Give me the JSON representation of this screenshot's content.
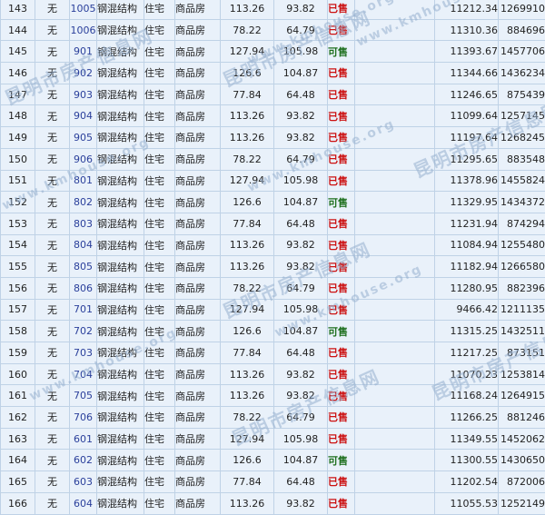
{
  "watermark": {
    "cn": "昆明市房产信息网",
    "en": "www.kmhouse.org"
  },
  "colors": {
    "sold": "#cc1111",
    "available": "#1d6f1d",
    "room": "#2a3f9b"
  },
  "rows": [
    {
      "idx": "143",
      "none": "无",
      "room": "1005",
      "struct": "钢混结构",
      "use": "住宅",
      "kind": "商品房",
      "area1": "113.26",
      "area2": "93.82",
      "status": "已售",
      "price": "11212.34",
      "total": "1269910"
    },
    {
      "idx": "144",
      "none": "无",
      "room": "1006",
      "struct": "钢混结构",
      "use": "住宅",
      "kind": "商品房",
      "area1": "78.22",
      "area2": "64.79",
      "status": "已售",
      "price": "11310.36",
      "total": "884696"
    },
    {
      "idx": "145",
      "none": "无",
      "room": "901",
      "struct": "钢混结构",
      "use": "住宅",
      "kind": "商品房",
      "area1": "127.94",
      "area2": "105.98",
      "status": "可售",
      "price": "11393.67",
      "total": "1457706"
    },
    {
      "idx": "146",
      "none": "无",
      "room": "902",
      "struct": "钢混结构",
      "use": "住宅",
      "kind": "商品房",
      "area1": "126.6",
      "area2": "104.87",
      "status": "已售",
      "price": "11344.66",
      "total": "1436234"
    },
    {
      "idx": "147",
      "none": "无",
      "room": "903",
      "struct": "钢混结构",
      "use": "住宅",
      "kind": "商品房",
      "area1": "77.84",
      "area2": "64.48",
      "status": "已售",
      "price": "11246.65",
      "total": "875439"
    },
    {
      "idx": "148",
      "none": "无",
      "room": "904",
      "struct": "钢混结构",
      "use": "住宅",
      "kind": "商品房",
      "area1": "113.26",
      "area2": "93.82",
      "status": "已售",
      "price": "11099.64",
      "total": "1257145"
    },
    {
      "idx": "149",
      "none": "无",
      "room": "905",
      "struct": "钢混结构",
      "use": "住宅",
      "kind": "商品房",
      "area1": "113.26",
      "area2": "93.82",
      "status": "已售",
      "price": "11197.64",
      "total": "1268245"
    },
    {
      "idx": "150",
      "none": "无",
      "room": "906",
      "struct": "钢混结构",
      "use": "住宅",
      "kind": "商品房",
      "area1": "78.22",
      "area2": "64.79",
      "status": "已售",
      "price": "11295.65",
      "total": "883548"
    },
    {
      "idx": "151",
      "none": "无",
      "room": "801",
      "struct": "钢混结构",
      "use": "住宅",
      "kind": "商品房",
      "area1": "127.94",
      "area2": "105.98",
      "status": "已售",
      "price": "11378.96",
      "total": "1455824"
    },
    {
      "idx": "152",
      "none": "无",
      "room": "802",
      "struct": "钢混结构",
      "use": "住宅",
      "kind": "商品房",
      "area1": "126.6",
      "area2": "104.87",
      "status": "可售",
      "price": "11329.95",
      "total": "1434372"
    },
    {
      "idx": "153",
      "none": "无",
      "room": "803",
      "struct": "钢混结构",
      "use": "住宅",
      "kind": "商品房",
      "area1": "77.84",
      "area2": "64.48",
      "status": "已售",
      "price": "11231.94",
      "total": "874294"
    },
    {
      "idx": "154",
      "none": "无",
      "room": "804",
      "struct": "钢混结构",
      "use": "住宅",
      "kind": "商品房",
      "area1": "113.26",
      "area2": "93.82",
      "status": "已售",
      "price": "11084.94",
      "total": "1255480"
    },
    {
      "idx": "155",
      "none": "无",
      "room": "805",
      "struct": "钢混结构",
      "use": "住宅",
      "kind": "商品房",
      "area1": "113.26",
      "area2": "93.82",
      "status": "已售",
      "price": "11182.94",
      "total": "1266580"
    },
    {
      "idx": "156",
      "none": "无",
      "room": "806",
      "struct": "钢混结构",
      "use": "住宅",
      "kind": "商品房",
      "area1": "78.22",
      "area2": "64.79",
      "status": "已售",
      "price": "11280.95",
      "total": "882396"
    },
    {
      "idx": "157",
      "none": "无",
      "room": "701",
      "struct": "钢混结构",
      "use": "住宅",
      "kind": "商品房",
      "area1": "127.94",
      "area2": "105.98",
      "status": "已售",
      "price": "9466.42",
      "total": "1211135"
    },
    {
      "idx": "158",
      "none": "无",
      "room": "702",
      "struct": "钢混结构",
      "use": "住宅",
      "kind": "商品房",
      "area1": "126.6",
      "area2": "104.87",
      "status": "可售",
      "price": "11315.25",
      "total": "1432511"
    },
    {
      "idx": "159",
      "none": "无",
      "room": "703",
      "struct": "钢混结构",
      "use": "住宅",
      "kind": "商品房",
      "area1": "77.84",
      "area2": "64.48",
      "status": "已售",
      "price": "11217.25",
      "total": "873151"
    },
    {
      "idx": "160",
      "none": "无",
      "room": "704",
      "struct": "钢混结构",
      "use": "住宅",
      "kind": "商品房",
      "area1": "113.26",
      "area2": "93.82",
      "status": "已售",
      "price": "11070.23",
      "total": "1253814"
    },
    {
      "idx": "161",
      "none": "无",
      "room": "705",
      "struct": "钢混结构",
      "use": "住宅",
      "kind": "商品房",
      "area1": "113.26",
      "area2": "93.82",
      "status": "已售",
      "price": "11168.24",
      "total": "1264915"
    },
    {
      "idx": "162",
      "none": "无",
      "room": "706",
      "struct": "钢混结构",
      "use": "住宅",
      "kind": "商品房",
      "area1": "78.22",
      "area2": "64.79",
      "status": "已售",
      "price": "11266.25",
      "total": "881246"
    },
    {
      "idx": "163",
      "none": "无",
      "room": "601",
      "struct": "钢混结构",
      "use": "住宅",
      "kind": "商品房",
      "area1": "127.94",
      "area2": "105.98",
      "status": "已售",
      "price": "11349.55",
      "total": "1452062"
    },
    {
      "idx": "164",
      "none": "无",
      "room": "602",
      "struct": "钢混结构",
      "use": "住宅",
      "kind": "商品房",
      "area1": "126.6",
      "area2": "104.87",
      "status": "可售",
      "price": "11300.55",
      "total": "1430650"
    },
    {
      "idx": "165",
      "none": "无",
      "room": "603",
      "struct": "钢混结构",
      "use": "住宅",
      "kind": "商品房",
      "area1": "77.84",
      "area2": "64.48",
      "status": "已售",
      "price": "11202.54",
      "total": "872006"
    },
    {
      "idx": "166",
      "none": "无",
      "room": "604",
      "struct": "钢混结构",
      "use": "住宅",
      "kind": "商品房",
      "area1": "113.26",
      "area2": "93.82",
      "status": "已售",
      "price": "11055.53",
      "total": "1252149"
    }
  ]
}
